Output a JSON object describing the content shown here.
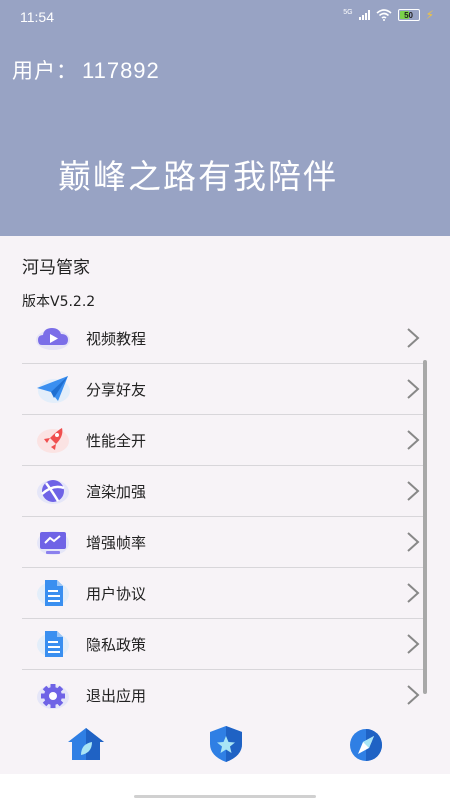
{
  "status_bar": {
    "time": "11:54",
    "network": "5G",
    "battery": "50",
    "icons": [
      "signal-icon",
      "wifi-icon",
      "battery-icon",
      "charging-icon"
    ]
  },
  "header": {
    "user_label": "用户：",
    "user_id": "117892",
    "slogan": "巅峰之路有我陪伴",
    "background": "#98a3c4"
  },
  "app": {
    "name": "河马管家",
    "version": "版本V5.2.2"
  },
  "menu": [
    {
      "label": "视频教程",
      "icon": "video-cloud-icon"
    },
    {
      "label": "分享好友",
      "icon": "paper-plane-icon"
    },
    {
      "label": "性能全开",
      "icon": "rocket-icon"
    },
    {
      "label": "渲染加强",
      "icon": "planet-icon"
    },
    {
      "label": "增强帧率",
      "icon": "monitor-icon"
    },
    {
      "label": "用户协议",
      "icon": "document-icon"
    },
    {
      "label": "隐私政策",
      "icon": "document-icon"
    },
    {
      "label": "退出应用",
      "icon": "gear-icon"
    }
  ],
  "bottom_nav": [
    {
      "icon": "home-icon"
    },
    {
      "icon": "shield-star-icon"
    },
    {
      "icon": "compass-icon"
    }
  ]
}
